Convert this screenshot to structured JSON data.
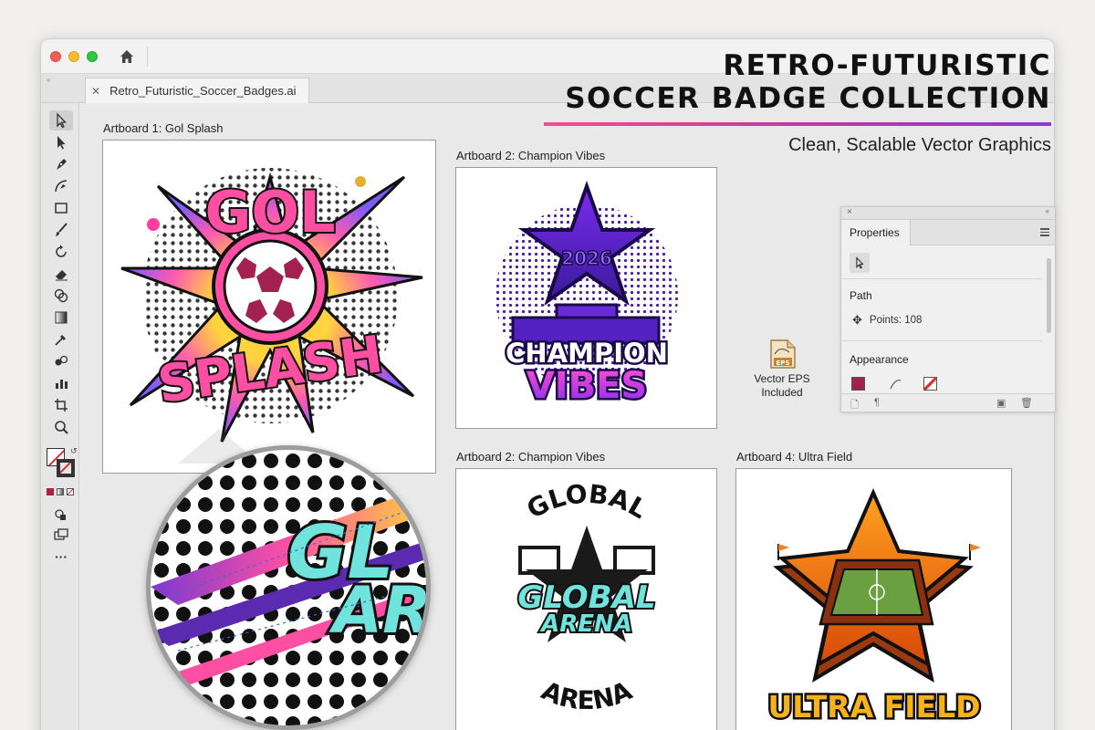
{
  "window": {
    "file_tab": "Retro_Futuristic_Soccer_Badges.ai",
    "collapse_mark": "«"
  },
  "heading": {
    "line1": "RETRO-FUTURISTIC",
    "line2": "SOCCER BADGE COLLECTION",
    "subtitle": "Clean, Scalable Vector Graphics",
    "rule_colors": [
      "#f05090",
      "#c03a9e",
      "#8a3ad0"
    ]
  },
  "artboards": [
    {
      "label": "Artboard 1: Gol Splash",
      "badge_text": [
        "GOL",
        "SPLASH"
      ]
    },
    {
      "label": "Artboard 2: Champion Vibes",
      "badge_text": [
        "2026",
        "CHAMPION",
        "VIBES"
      ]
    },
    {
      "label": "Artboard 2: Champion Vibes",
      "badge_text": [
        "GLOBAL",
        "GLOBAL",
        "ARENA",
        "ARENA"
      ]
    },
    {
      "label": "Artboard 4: Ultra Field",
      "badge_text": [
        "ULTRA FIELD"
      ]
    }
  ],
  "magnifier": {
    "text": [
      "GL",
      "AR"
    ]
  },
  "properties_panel": {
    "tab": "Properties",
    "close": "×",
    "collapse": "«",
    "section_path": "Path",
    "points": "Points: 108",
    "section_appearance": "Appearance",
    "fill_color": "#a3214e"
  },
  "eps_badge": {
    "icon_text": "EPS",
    "line1": "Vector EPS",
    "line2": "Included"
  },
  "toolbar": {
    "tools": [
      "selection-tool",
      "direct-selection-tool",
      "pen-tool",
      "curvature-tool",
      "rectangle-tool",
      "paintbrush-tool",
      "rotate-tool",
      "eraser-tool",
      "shape-builder-tool",
      "gradient-tool",
      "eyedropper-tool",
      "blend-tool",
      "graph-tool",
      "artboard-tool",
      "zoom-tool"
    ],
    "more": "···"
  },
  "colors": {
    "pink": "#ff4fa3",
    "purple": "#6a2bd6",
    "teal": "#5ee0e0",
    "orange": "#f06a10"
  }
}
